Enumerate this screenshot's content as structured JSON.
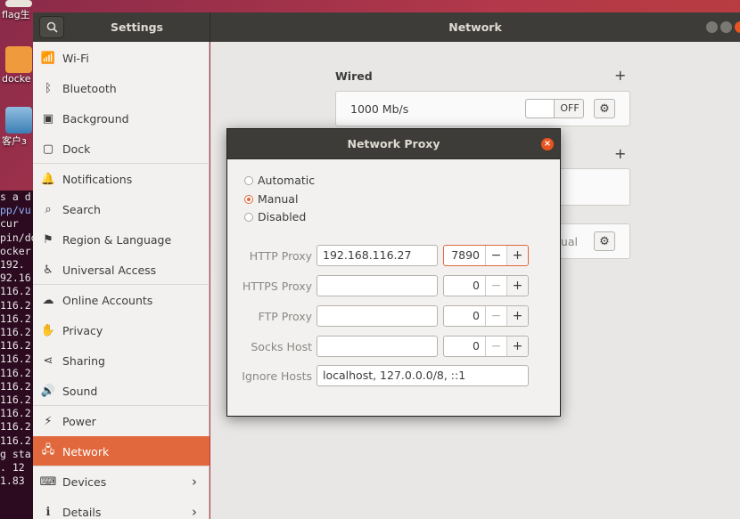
{
  "desktop": {
    "icons": [
      {
        "label": "flag生"
      },
      {
        "label": "docke"
      },
      {
        "label": "客户ɜ"
      }
    ],
    "terminal_lines": [
      "s a d",
      "pp/vu",
      "  cur",
      "pin/do",
      "ocker",
      " 192.",
      "92.16",
      "116.2",
      "116.2",
      "116.2",
      "116.2",
      "116.2",
      "116.2",
      "116.2",
      "116.2",
      "116.2",
      "116.2",
      "116.2",
      "116.2",
      "",
      "g sta",
      ". 12",
      " 1.83"
    ]
  },
  "window": {
    "settings_title": "Settings",
    "panel_title": "Network"
  },
  "sidebar": {
    "items": [
      {
        "label": "Wi-Fi",
        "icon": "wifi-icon"
      },
      {
        "label": "Bluetooth",
        "icon": "bluetooth-icon"
      },
      {
        "label": "Background",
        "icon": "background-icon"
      },
      {
        "label": "Dock",
        "icon": "dock-icon"
      },
      {
        "label": "Notifications",
        "icon": "bell-icon"
      },
      {
        "label": "Search",
        "icon": "search-icon"
      },
      {
        "label": "Region & Language",
        "icon": "region-icon"
      },
      {
        "label": "Universal Access",
        "icon": "accessibility-icon"
      },
      {
        "label": "Online Accounts",
        "icon": "online-accounts-icon"
      },
      {
        "label": "Privacy",
        "icon": "hand-icon"
      },
      {
        "label": "Sharing",
        "icon": "share-icon"
      },
      {
        "label": "Sound",
        "icon": "speaker-icon"
      },
      {
        "label": "Power",
        "icon": "power-icon"
      },
      {
        "label": "Network",
        "icon": "network-icon",
        "active": true
      },
      {
        "label": "Devices",
        "icon": "devices-icon"
      },
      {
        "label": "Details",
        "icon": "info-icon"
      }
    ]
  },
  "network": {
    "wired_title": "Wired",
    "wired_speed": "1000 Mb/s",
    "toggle_state": "OFF",
    "proxy_mode_fragment": "nual"
  },
  "dialog": {
    "title": "Network Proxy",
    "modes": [
      {
        "label": "Automatic",
        "selected": false
      },
      {
        "label": "Manual",
        "selected": true
      },
      {
        "label": "Disabled",
        "selected": false
      }
    ],
    "rows": [
      {
        "label": "HTTP Proxy",
        "host": "192.168.116.27",
        "port": "7890"
      },
      {
        "label": "HTTPS Proxy",
        "host": "",
        "port": "0"
      },
      {
        "label": "FTP Proxy",
        "host": "",
        "port": "0"
      },
      {
        "label": "Socks Host",
        "host": "",
        "port": "0"
      }
    ],
    "ignore_label": "Ignore Hosts",
    "ignore_value": "localhost, 127.0.0.0/8, ::1"
  },
  "colors": {
    "accent": "#e0683c",
    "titlebar": "#3d3c38",
    "close_button": "#e95420"
  }
}
